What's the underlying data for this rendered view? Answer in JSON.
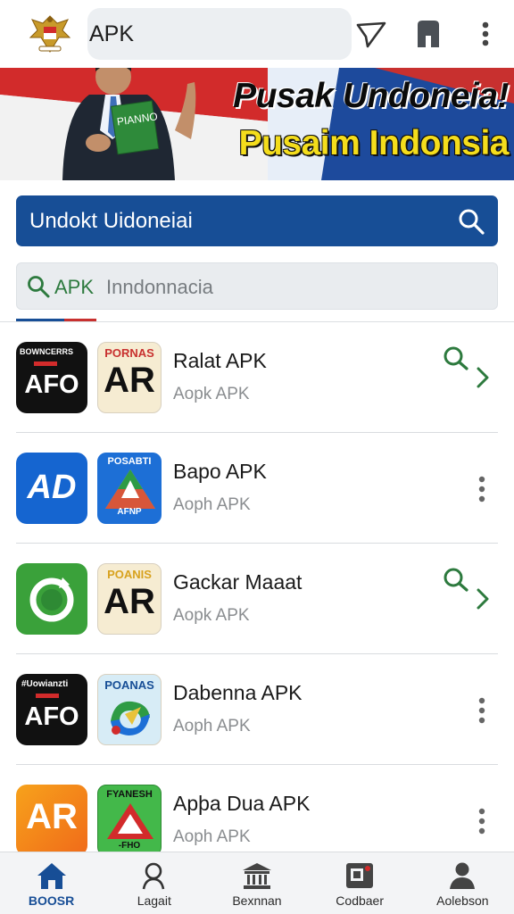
{
  "header": {
    "address_text": "APK",
    "icons": [
      "garuda-emblem-icon",
      "filter-icon",
      "bookmark-icon",
      "more-vertical-icon"
    ]
  },
  "banner": {
    "line1": "Pusak Undoneia!",
    "line2": "Pusaim Indonsia",
    "book_text": "PIANNO"
  },
  "search_primary": {
    "text": "Undokt Uidoneiai"
  },
  "search_secondary": {
    "chip": "APK",
    "placeholder": "Inndonnacia"
  },
  "apps": [
    {
      "title": "Ralat APK",
      "subtitle": "Aopk APK",
      "icon1_label": "AFO",
      "icon1_top": "BOWNCERRS",
      "icon2_top": "PORNAS",
      "icon2_main": "AR",
      "action": "search-chevron"
    },
    {
      "title": "Bapo APK",
      "subtitle": "Aoph APK",
      "icon1_label": "AD",
      "icon2_top": "POSABTI",
      "icon2_bottom": "AFNP",
      "action": "more"
    },
    {
      "title": "Gackar Maaat",
      "subtitle": "Aopk APK",
      "icon2_top": "POANIS",
      "icon2_main": "AR",
      "action": "search-chevron"
    },
    {
      "title": "Dabenna APK",
      "subtitle": "Aoph APK",
      "icon1_label": "AFO",
      "icon1_top": "#Uowianzti",
      "icon2_top": "POANAS",
      "action": "more"
    },
    {
      "title": "Apþa Dua APK",
      "subtitle": "Aoph APK",
      "icon1_label": "AR",
      "icon2_top": "FYANESH",
      "icon2_bottom": "-FHO",
      "action": "more"
    }
  ],
  "bottom_nav": [
    {
      "label": "BOOSR",
      "icon": "home-icon",
      "active": true
    },
    {
      "label": "Lagait",
      "icon": "person-search-icon",
      "active": false
    },
    {
      "label": "Bexnnan",
      "icon": "bank-icon",
      "active": false
    },
    {
      "label": "Codbaer",
      "icon": "scanner-icon",
      "active": false
    },
    {
      "label": "Aolebson",
      "icon": "profile-icon",
      "active": false
    }
  ],
  "colors": {
    "primary_blue": "#174e96",
    "green_accent": "#2d7a3e",
    "banner_yellow": "#f4dd1c",
    "flag_red": "#d22b2b"
  }
}
